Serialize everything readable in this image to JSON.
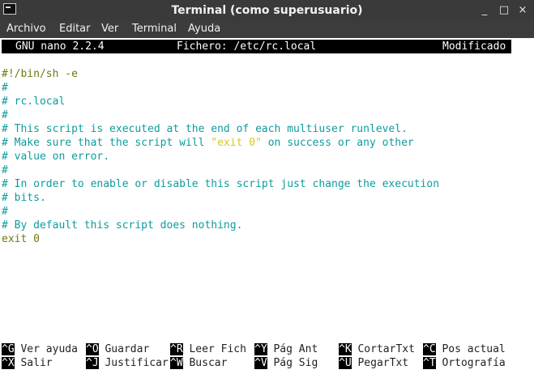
{
  "window": {
    "title": "Terminal (como superusuario)",
    "minimize_glyph": "_",
    "maximize_glyph": "□",
    "close_glyph": "×"
  },
  "menu": [
    "Archivo",
    "Editar",
    "Ver",
    "Terminal",
    "Ayuda"
  ],
  "nano": {
    "version": "GNU nano 2.2.4",
    "file": "Fichero: /etc/rc.local",
    "status": "Modificado"
  },
  "lines": [
    "#!/bin/sh -e",
    "#",
    "# rc.local",
    "#",
    "# This script is executed at the end of each multiuser runlevel.",
    "# Make sure that the script will ",
    "\"exit 0\"",
    " on success or any other",
    "# value on error.",
    "#",
    "# In order to enable or disable this script just change the execution",
    "# bits.",
    "#",
    "# By default this script does nothing.",
    "exit 0"
  ],
  "shortcuts_row1": [
    {
      "key": "^G",
      "label": "Ver ayuda"
    },
    {
      "key": "^O",
      "label": "Guardar"
    },
    {
      "key": "^R",
      "label": "Leer Fich"
    },
    {
      "key": "^Y",
      "label": "Pág Ant"
    },
    {
      "key": "^K",
      "label": "CortarTxt"
    },
    {
      "key": "^C",
      "label": "Pos actual"
    }
  ],
  "shortcuts_row2": [
    {
      "key": "^X",
      "label": "Salir"
    },
    {
      "key": "^J",
      "label": "Justificar"
    },
    {
      "key": "^W",
      "label": "Buscar"
    },
    {
      "key": "^V",
      "label": "Pág Sig"
    },
    {
      "key": "^U",
      "label": "PegarTxt"
    },
    {
      "key": "^T",
      "label": "Ortografía"
    }
  ],
  "colors": {
    "comment": "#0f9b9b",
    "code": "#6e7a10",
    "string": "#d7c81e"
  }
}
